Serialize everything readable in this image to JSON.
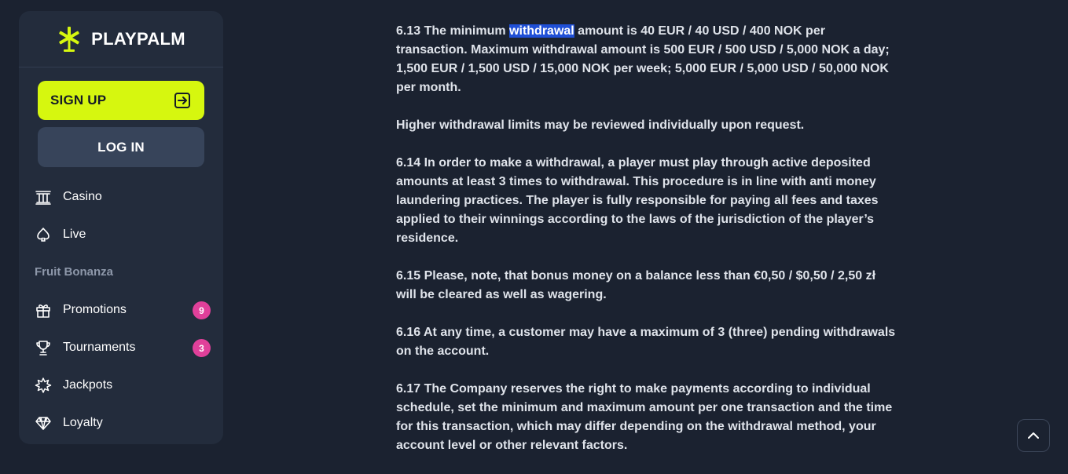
{
  "brand": {
    "name": "PLAYPALM",
    "accent": "#d6f70f"
  },
  "auth": {
    "signup_label": "SIGN UP",
    "login_label": "LOG IN"
  },
  "nav": {
    "casino": "Casino",
    "live": "Live",
    "section": "Fruit Bonanza",
    "promotions": {
      "label": "Promotions",
      "badge": "9"
    },
    "tournaments": {
      "label": "Tournaments",
      "badge": "3"
    },
    "jackpots": "Jackpots",
    "loyalty": "Loyalty"
  },
  "terms": {
    "p613_pre": "6.13 The minimum ",
    "p613_hl": "withdrawal",
    "p613_post": " amount is 40 EUR / 40 USD / 400 NOK per transaction. Maximum withdrawal amount is 500 EUR / 500 USD / 5,000 NOK a day; 1,500 EUR / 1,500 USD / 15,000 NOK per week; 5,000 EUR / 5,000 USD / 50,000 NOK per month.",
    "p_limits": "Higher withdrawal limits may be reviewed individually upon request.",
    "p614": "6.14 In order to make a withdrawal, a player must play through active deposited amounts at least 3 times to withdrawal. This procedure is in line with anti money laundering practices. The player is fully responsible for paying all fees and taxes applied to their winnings according to the laws of the jurisdiction of the player’s residence.",
    "p615": "6.15 Please, note, that bonus money on a balance less than €0,50 / $0,50 / 2,50 zł will be cleared as well as wagering.",
    "p616": "6.16 At any time, a customer may have a maximum of 3 (three) pending withdrawals on the account.",
    "p617": "6.17 The Company reserves the right to make payments according to individual schedule, set the minimum and maximum amount per one transaction and the time for this transaction, which may differ depending on the withdrawal method, your account level or other relevant factors."
  },
  "icons": {
    "logo": "palm-logo-icon",
    "signup": "login-arrow-icon",
    "casino": "casino-building-icon",
    "live": "spade-icon",
    "promotions": "gift-icon",
    "tournaments": "trophy-icon",
    "jackpots": "starburst-icon",
    "loyalty": "diamond-icon",
    "scroll_top": "chevron-up-icon"
  }
}
